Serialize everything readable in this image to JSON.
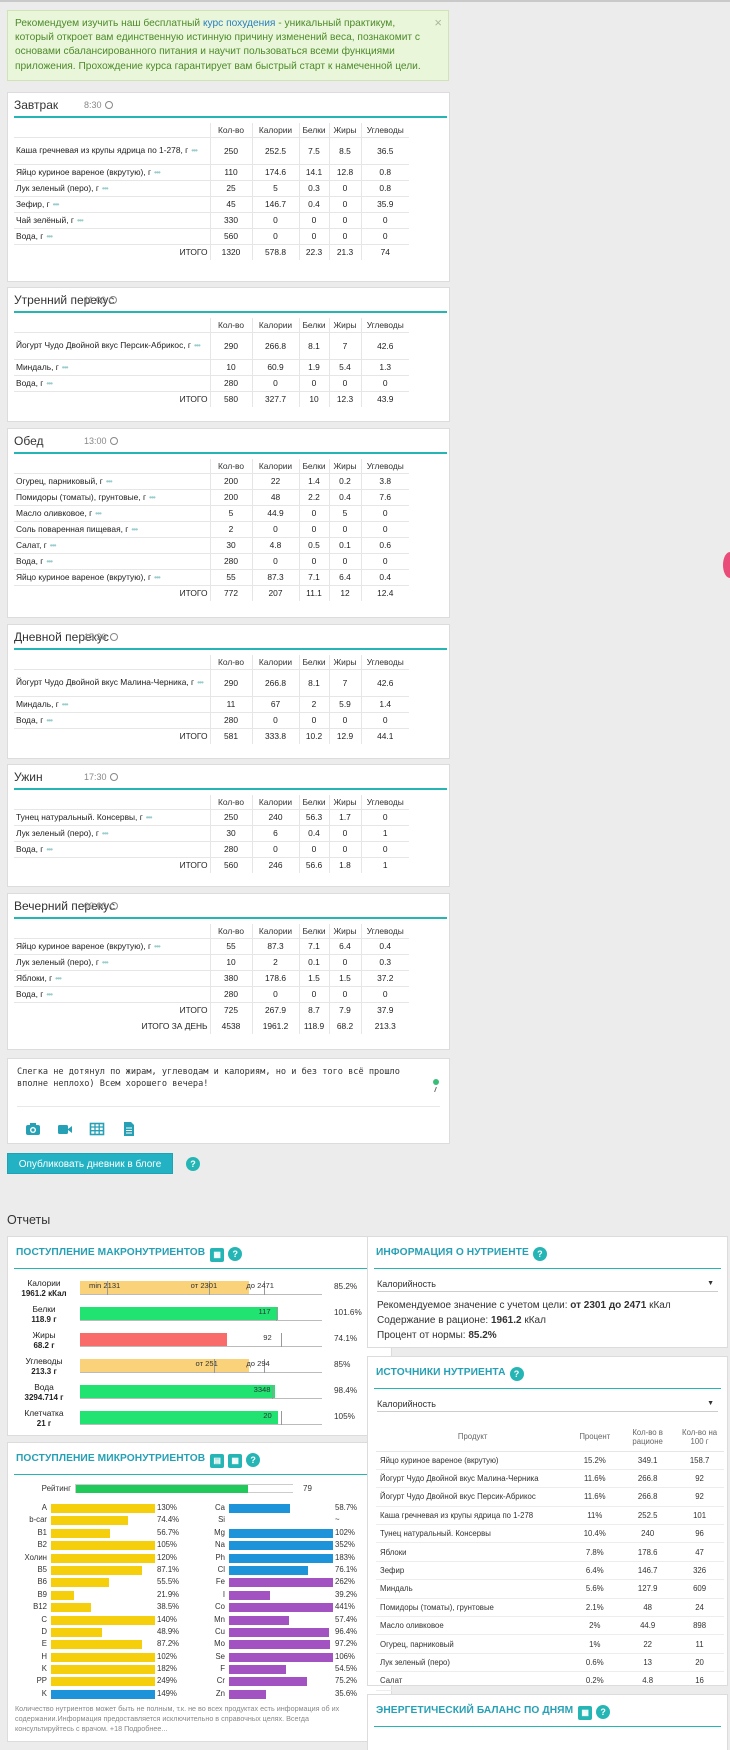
{
  "notice": {
    "text_before": "Рекомендуем изучить наш бесплатный ",
    "link": "курс похудения",
    "text_after": " - уникальный практикум, который откроет вам единственную истинную причину изменений веса, познакомит с основами сбалансированного питания и научит пользоваться всеми функциями приложения. Прохождение курса гарантирует вам быстрый старт к намеченной цели.",
    "close": "×"
  },
  "columns": [
    "Кол-во",
    "Калории",
    "Белки",
    "Жиры",
    "Углеводы"
  ],
  "meals": [
    {
      "title": "Завтрак",
      "time": "8:30",
      "rows": [
        {
          "name": "Каша гречневая из крупы ядрица по 1-278, г",
          "qty": "250",
          "cal": "252.5",
          "prot": "7.5",
          "fat": "8.5",
          "carb": "36.5"
        },
        {
          "name": "Яйцо куриное вареное (вкрутую), г",
          "qty": "110",
          "cal": "174.6",
          "prot": "14.1",
          "fat": "12.8",
          "carb": "0.8"
        },
        {
          "name": "Лук зеленый (перо), г",
          "qty": "25",
          "cal": "5",
          "prot": "0.3",
          "fat": "0",
          "carb": "0.8"
        },
        {
          "name": "Зефир, г",
          "qty": "45",
          "cal": "146.7",
          "prot": "0.4",
          "fat": "0",
          "carb": "35.9"
        },
        {
          "name": "Чай зелёный, г",
          "qty": "330",
          "cal": "0",
          "prot": "0",
          "fat": "0",
          "carb": "0"
        },
        {
          "name": "Вода, г",
          "qty": "560",
          "cal": "0",
          "prot": "0",
          "fat": "0",
          "carb": "0"
        }
      ],
      "total": {
        "label": "ИТОГО",
        "qty": "1320",
        "cal": "578.8",
        "prot": "22.3",
        "fat": "21.3",
        "carb": "74"
      }
    },
    {
      "title": "Утренний перекус",
      "time": "11:00",
      "rows": [
        {
          "name": "Йогурт Чудо Двойной вкус Персик-Абрикос, г",
          "qty": "290",
          "cal": "266.8",
          "prot": "8.1",
          "fat": "7",
          "carb": "42.6"
        },
        {
          "name": "Миндаль, г",
          "qty": "10",
          "cal": "60.9",
          "prot": "1.9",
          "fat": "5.4",
          "carb": "1.3"
        },
        {
          "name": "Вода, г",
          "qty": "280",
          "cal": "0",
          "prot": "0",
          "fat": "0",
          "carb": "0"
        }
      ],
      "total": {
        "label": "ИТОГО",
        "qty": "580",
        "cal": "327.7",
        "prot": "10",
        "fat": "12.3",
        "carb": "43.9"
      }
    },
    {
      "title": "Обед",
      "time": "13:00",
      "rows": [
        {
          "name": "Огурец, парниковый, г",
          "qty": "200",
          "cal": "22",
          "prot": "1.4",
          "fat": "0.2",
          "carb": "3.8"
        },
        {
          "name": "Помидоры (томаты), грунтовые, г",
          "qty": "200",
          "cal": "48",
          "prot": "2.2",
          "fat": "0.4",
          "carb": "7.6"
        },
        {
          "name": "Масло оливковое, г",
          "qty": "5",
          "cal": "44.9",
          "prot": "0",
          "fat": "5",
          "carb": "0"
        },
        {
          "name": "Соль поваренная пищевая, г",
          "qty": "2",
          "cal": "0",
          "prot": "0",
          "fat": "0",
          "carb": "0"
        },
        {
          "name": "Салат, г",
          "qty": "30",
          "cal": "4.8",
          "prot": "0.5",
          "fat": "0.1",
          "carb": "0.6"
        },
        {
          "name": "Вода, г",
          "qty": "280",
          "cal": "0",
          "prot": "0",
          "fat": "0",
          "carb": "0"
        },
        {
          "name": "Яйцо куриное вареное (вкрутую), г",
          "qty": "55",
          "cal": "87.3",
          "prot": "7.1",
          "fat": "6.4",
          "carb": "0.4"
        }
      ],
      "total": {
        "label": "ИТОГО",
        "qty": "772",
        "cal": "207",
        "prot": "11.1",
        "fat": "12",
        "carb": "12.4"
      }
    },
    {
      "title": "Дневной перекус",
      "time": "15:30",
      "rows": [
        {
          "name": "Йогурт Чудо Двойной вкус Малина-Черника, г",
          "qty": "290",
          "cal": "266.8",
          "prot": "8.1",
          "fat": "7",
          "carb": "42.6"
        },
        {
          "name": "Миндаль, г",
          "qty": "11",
          "cal": "67",
          "prot": "2",
          "fat": "5.9",
          "carb": "1.4"
        },
        {
          "name": "Вода, г",
          "qty": "280",
          "cal": "0",
          "prot": "0",
          "fat": "0",
          "carb": "0"
        }
      ],
      "total": {
        "label": "ИТОГО",
        "qty": "581",
        "cal": "333.8",
        "prot": "10.2",
        "fat": "12.9",
        "carb": "44.1"
      }
    },
    {
      "title": "Ужин",
      "time": "17:30",
      "rows": [
        {
          "name": "Тунец натуральный. Консервы, г",
          "qty": "250",
          "cal": "240",
          "prot": "56.3",
          "fat": "1.7",
          "carb": "0"
        },
        {
          "name": "Лук зеленый (перо), г",
          "qty": "30",
          "cal": "6",
          "prot": "0.4",
          "fat": "0",
          "carb": "1"
        },
        {
          "name": "Вода, г",
          "qty": "280",
          "cal": "0",
          "prot": "0",
          "fat": "0",
          "carb": "0"
        }
      ],
      "total": {
        "label": "ИТОГО",
        "qty": "560",
        "cal": "246",
        "prot": "56.6",
        "fat": "1.8",
        "carb": "1"
      }
    },
    {
      "title": "Вечерний перекус",
      "time": "00:00",
      "rows": [
        {
          "name": "Яйцо куриное вареное (вкрутую), г",
          "qty": "55",
          "cal": "87.3",
          "prot": "7.1",
          "fat": "6.4",
          "carb": "0.4"
        },
        {
          "name": "Лук зеленый (перо), г",
          "qty": "10",
          "cal": "2",
          "prot": "0.1",
          "fat": "0",
          "carb": "0.3"
        },
        {
          "name": "Яблоки, г",
          "qty": "380",
          "cal": "178.6",
          "prot": "1.5",
          "fat": "1.5",
          "carb": "37.2"
        },
        {
          "name": "Вода, г",
          "qty": "280",
          "cal": "0",
          "prot": "0",
          "fat": "0",
          "carb": "0"
        }
      ],
      "total": {
        "label": "ИТОГО",
        "qty": "725",
        "cal": "267.9",
        "prot": "8.7",
        "fat": "7.9",
        "carb": "37.9"
      },
      "day_total": {
        "label": "ИТОГО ЗА ДЕНЬ",
        "qty": "4538",
        "cal": "1961.2",
        "prot": "118.9",
        "fat": "68.2",
        "carb": "213.3"
      }
    }
  ],
  "comment": {
    "text": "Слегка не дотянул по жирам, углеводам и калориям, но и без того всё прошло вполне неплохо) Всем хорошего вечера!"
  },
  "publish": {
    "label": "Опубликовать дневник в блоге"
  },
  "reports_title": "Отчеты",
  "macro": {
    "title": "ПОСТУПЛЕНИЕ МАКРОНУТРИЕНТОВ",
    "rows": [
      {
        "name": "Калории",
        "amount": "1961.2 кКал",
        "pct": "85.2%",
        "value": 0.852,
        "color": "#f9d27a",
        "labels": [
          {
            "t": "min 2131",
            "at": 0.12
          },
          {
            "t": "от 2301",
            "at": 0.54
          },
          {
            "t": "до 2471",
            "at": 0.77
          }
        ]
      },
      {
        "name": "Белки",
        "amount": "118.9 г",
        "pct": "101.6%",
        "value": 1.016,
        "color": "#20e372",
        "labels": [
          {
            "t": "117",
            "at": 0.82
          }
        ]
      },
      {
        "name": "Жиры",
        "amount": "68.2 г",
        "pct": "74.1%",
        "value": 0.741,
        "color": "#f96a6a",
        "labels": [
          {
            "t": "92",
            "at": 0.84
          }
        ]
      },
      {
        "name": "Углеводы",
        "amount": "213.3 г",
        "pct": "85%",
        "value": 0.85,
        "color": "#f9d27a",
        "labels": [
          {
            "t": "от 251",
            "at": 0.56
          },
          {
            "t": "до 294",
            "at": 0.77
          }
        ]
      },
      {
        "name": "Вода",
        "amount": "3294.714 г",
        "pct": "98.4%",
        "value": 0.984,
        "color": "#20e372",
        "labels": [
          {
            "t": "3348",
            "at": 0.8
          }
        ]
      },
      {
        "name": "Клетчатка",
        "amount": "21 г",
        "pct": "105%",
        "value": 1.05,
        "color": "#20e372",
        "labels": [
          {
            "t": "20",
            "at": 0.84
          }
        ]
      }
    ]
  },
  "micro": {
    "title": "ПОСТУПЛЕНИЕ МИКРОНУТРИЕНТОВ",
    "rating": {
      "label": "Рейтинг",
      "pct": "79",
      "value": 0.79
    },
    "left": [
      {
        "n": "A",
        "p": "130%",
        "v": 1.3,
        "c": "#f5cf0c"
      },
      {
        "n": "b-car",
        "p": "74.4%",
        "v": 0.744,
        "c": "#f5cf0c"
      },
      {
        "n": "B1",
        "p": "56.7%",
        "v": 0.567,
        "c": "#f5cf0c"
      },
      {
        "n": "B2",
        "p": "105%",
        "v": 1.05,
        "c": "#f5cf0c"
      },
      {
        "n": "Холин",
        "p": "120%",
        "v": 1.2,
        "c": "#f5cf0c"
      },
      {
        "n": "B5",
        "p": "87.1%",
        "v": 0.871,
        "c": "#f5cf0c"
      },
      {
        "n": "B6",
        "p": "55.5%",
        "v": 0.555,
        "c": "#f5cf0c"
      },
      {
        "n": "B9",
        "p": "21.9%",
        "v": 0.219,
        "c": "#f5cf0c"
      },
      {
        "n": "B12",
        "p": "38.5%",
        "v": 0.385,
        "c": "#f5cf0c"
      },
      {
        "n": "C",
        "p": "140%",
        "v": 1.4,
        "c": "#f5cf0c"
      },
      {
        "n": "D",
        "p": "48.9%",
        "v": 0.489,
        "c": "#f5cf0c"
      },
      {
        "n": "E",
        "p": "87.2%",
        "v": 0.872,
        "c": "#f5cf0c"
      },
      {
        "n": "H",
        "p": "102%",
        "v": 1.02,
        "c": "#f5cf0c"
      },
      {
        "n": "K",
        "p": "182%",
        "v": 1.82,
        "c": "#f5cf0c"
      },
      {
        "n": "PP",
        "p": "249%",
        "v": 2.49,
        "c": "#f5cf0c"
      },
      {
        "n": "K",
        "p": "149%",
        "v": 1.49,
        "c": "#1d94d9"
      }
    ],
    "right": [
      {
        "n": "Ca",
        "p": "58.7%",
        "v": 0.587,
        "c": "#1d94d9"
      },
      {
        "n": "Si",
        "p": "~",
        "v": 0,
        "c": "#1d94d9"
      },
      {
        "n": "Mg",
        "p": "102%",
        "v": 1.02,
        "c": "#1d94d9"
      },
      {
        "n": "Na",
        "p": "352%",
        "v": 3.52,
        "c": "#1d94d9"
      },
      {
        "n": "Ph",
        "p": "183%",
        "v": 1.83,
        "c": "#1d94d9"
      },
      {
        "n": "Cl",
        "p": "76.1%",
        "v": 0.761,
        "c": "#1d94d9"
      },
      {
        "n": "Fe",
        "p": "262%",
        "v": 2.62,
        "c": "#a352c2"
      },
      {
        "n": "I",
        "p": "39.2%",
        "v": 0.392,
        "c": "#a352c2"
      },
      {
        "n": "Co",
        "p": "441%",
        "v": 4.41,
        "c": "#a352c2"
      },
      {
        "n": "Mn",
        "p": "57.4%",
        "v": 0.574,
        "c": "#a352c2"
      },
      {
        "n": "Cu",
        "p": "96.4%",
        "v": 0.964,
        "c": "#a352c2"
      },
      {
        "n": "Mo",
        "p": "97.2%",
        "v": 0.972,
        "c": "#a352c2"
      },
      {
        "n": "Se",
        "p": "106%",
        "v": 1.06,
        "c": "#a352c2"
      },
      {
        "n": "F",
        "p": "54.5%",
        "v": 0.545,
        "c": "#a352c2"
      },
      {
        "n": "Cr",
        "p": "75.2%",
        "v": 0.752,
        "c": "#a352c2"
      },
      {
        "n": "Zn",
        "p": "35.6%",
        "v": 0.356,
        "c": "#a352c2"
      }
    ],
    "note": "Количество нутриентов может быть не полным, т.к. не во всех продуктах есть информация об их содержании.Информация предоставляется исключительно в справочных целях. Всегда консультируйтесь с врачом. +18 Подробнее..."
  },
  "nutrient_info": {
    "title": "ИНФОРМАЦИЯ О НУТРИЕНТЕ",
    "select": "Калорийность",
    "rec_label": "Рекомендуемое значение с учетом цели: ",
    "rec_value": "от 2301 до 2471",
    "rec_unit": " кКал",
    "content_label": "Содержание в рационе: ",
    "content_value": "1961.2",
    "content_unit": " кКал",
    "pct_label": "Процент от нормы: ",
    "pct_value": "85.2%"
  },
  "sources": {
    "title": "ИСТОЧНИКИ НУТРИЕНТА",
    "select": "Калорийность",
    "headers": [
      "Продукт",
      "Процент",
      "Кол-во в рационе",
      "Кол-во на 100 г"
    ],
    "rows": [
      [
        "Яйцо куриное вареное (вкрутую)",
        "15.2%",
        "349.1",
        "158.7"
      ],
      [
        "Йогурт Чудо Двойной вкус Малина-Черника",
        "11.6%",
        "266.8",
        "92"
      ],
      [
        "Йогурт Чудо Двойной вкус Персик-Абрикос",
        "11.6%",
        "266.8",
        "92"
      ],
      [
        "Каша гречневая из крупы ядрица по 1-278",
        "11%",
        "252.5",
        "101"
      ],
      [
        "Тунец натуральный. Консервы",
        "10.4%",
        "240",
        "96"
      ],
      [
        "Яблоки",
        "7.8%",
        "178.6",
        "47"
      ],
      [
        "Зефир",
        "6.4%",
        "146.7",
        "326"
      ],
      [
        "Миндаль",
        "5.6%",
        "127.9",
        "609"
      ],
      [
        "Помидоры (томаты), грунтовые",
        "2.1%",
        "48",
        "24"
      ],
      [
        "Масло оливковое",
        "2%",
        "44.9",
        "898"
      ],
      [
        "Огурец, парниковый",
        "1%",
        "22",
        "11"
      ],
      [
        "Лук зеленый (перо)",
        "0.6%",
        "13",
        "20"
      ],
      [
        "Салат",
        "0.2%",
        "4.8",
        "16"
      ]
    ]
  },
  "energy": {
    "title": "ЭНЕРГЕТИЧЕСКИЙ БАЛАНС ПО ДНЯМ"
  },
  "colors": {
    "accent": "#26b5b5",
    "button": "#23b2c4"
  }
}
